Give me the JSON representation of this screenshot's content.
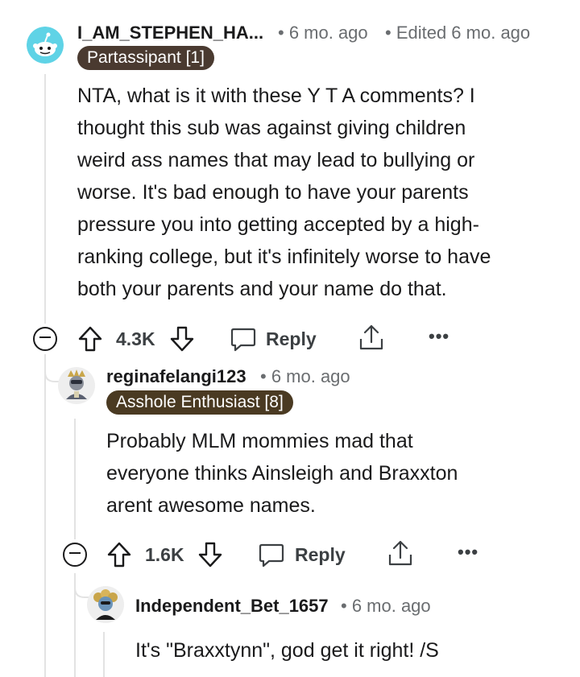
{
  "comments": [
    {
      "username": "I_AM_STEPHEN_HA...",
      "time": "• 6 mo. ago",
      "edited": "• Edited 6 mo. ago",
      "flair": "Partassipant [1]",
      "flair_bg": "#4a3a30",
      "flair_color": "#ffffff",
      "avatar_icon": "reddit-snoo-icon",
      "avatar_bg": "#5fd3e6",
      "lines": [
        "NTA, what is it with these Y T A comments? I",
        "thought this sub was against giving children",
        "weird ass names that may lead to bullying or",
        "worse. It's bad enough to have your parents",
        "pressure you into getting accepted by a high-",
        "ranking college, but it's infinitely worse to have",
        "both your parents and your name do that."
      ],
      "votes": "4.3K",
      "reply_label": "Reply"
    },
    {
      "username": "reginafelangi123",
      "time": "• 6 mo. ago",
      "flair": "Asshole Enthusiast [8]",
      "flair_bg": "#4a3a22",
      "flair_color": "#ffffff",
      "avatar_icon": "custom-avatar-icon",
      "lines": [
        "Probably MLM mommies mad that",
        "everyone thinks Ainsleigh and Braxxton",
        "arent awesome names."
      ],
      "votes": "1.6K",
      "reply_label": "Reply"
    },
    {
      "username": "Independent_Bet_1657",
      "time": "• 6 mo. ago",
      "avatar_icon": "custom-avatar-icon",
      "lines": [
        "It's \"Braxxtynn\", god get it right! /S"
      ]
    }
  ]
}
